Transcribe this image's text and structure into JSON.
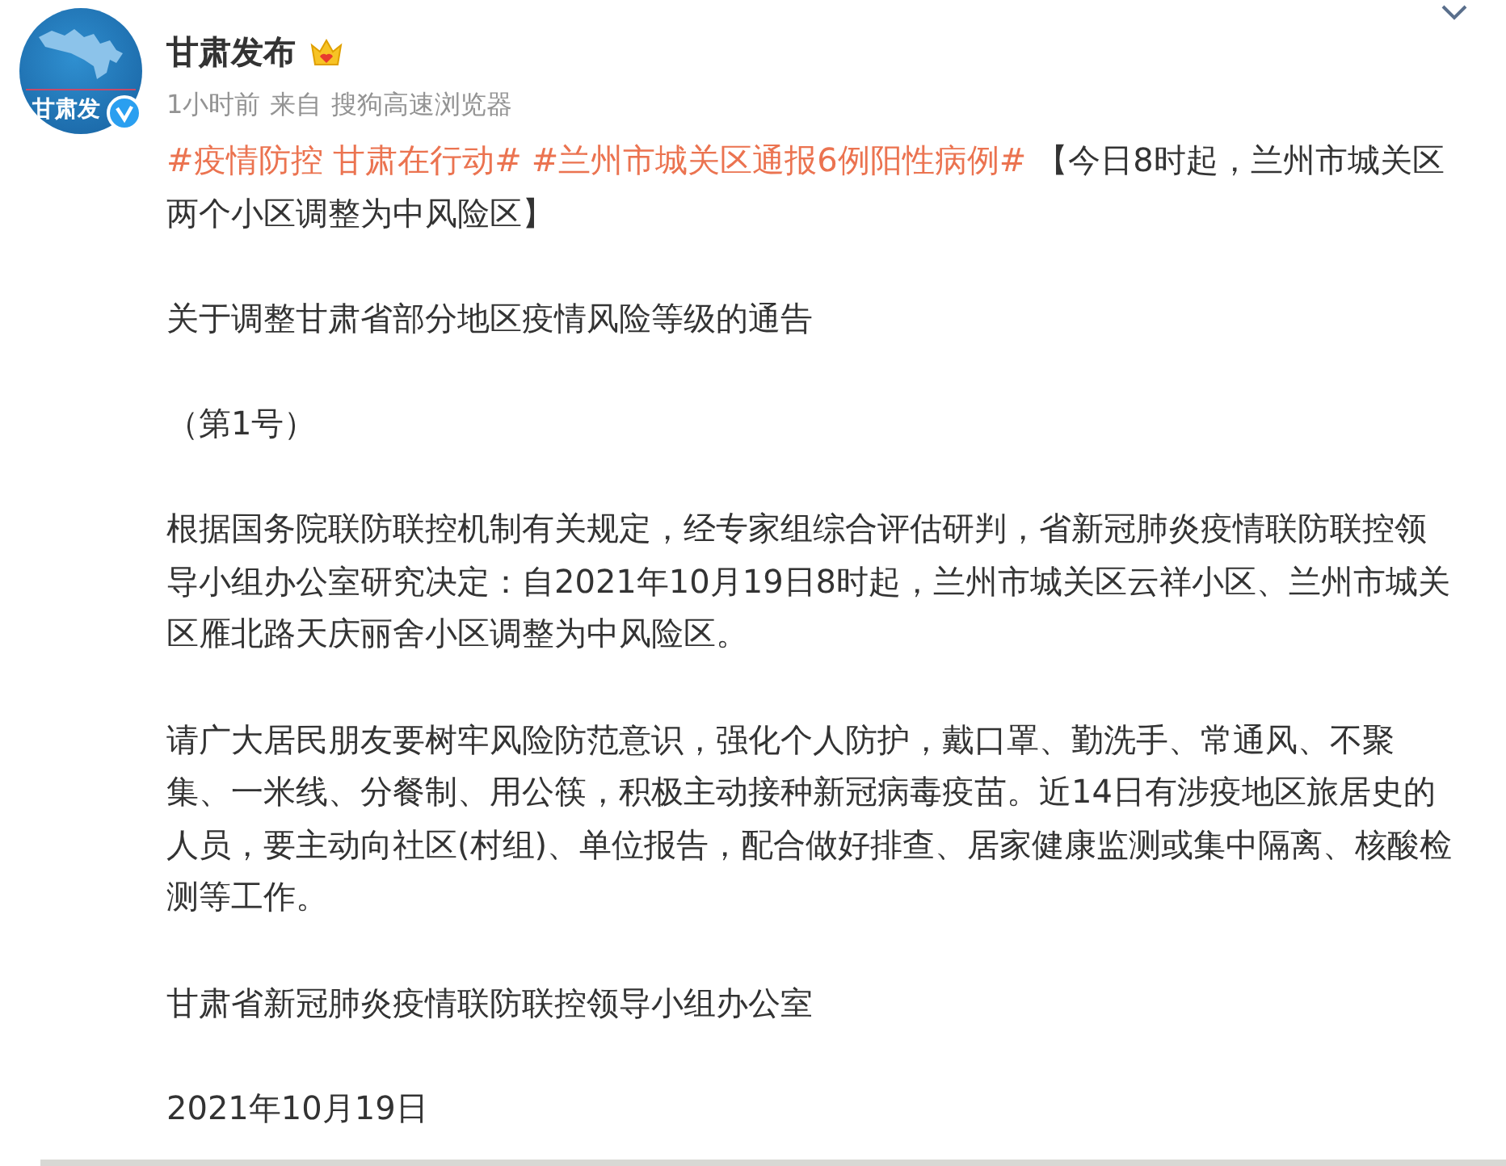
{
  "author": {
    "name": "甘肃发布",
    "avatar_text": "甘肃发"
  },
  "meta": {
    "time": "1小时前",
    "source_label": "来自",
    "source": "搜狗高速浏览器"
  },
  "post": [
    {
      "segments": [
        {
          "kind": "topic",
          "text": "#疫情防控 甘肃在行动#"
        },
        {
          "kind": "topic",
          "text": "#兰州市城关区通报6例阳性病例#"
        },
        {
          "kind": "text",
          "text": "【今日8时起，兰州市城关区两个小区调整为中风险区】"
        }
      ]
    },
    {
      "segments": [
        {
          "kind": "text",
          "text": "关于调整甘肃省部分地区疫情风险等级的通告"
        }
      ]
    },
    {
      "segments": [
        {
          "kind": "text",
          "text": "（第1号）"
        }
      ]
    },
    {
      "segments": [
        {
          "kind": "text",
          "text": "根据国务院联防联控机制有关规定，经专家组综合评估研判，省新冠肺炎疫情联防联控领导小组办公室研究决定：自2021年10月19日8时起，兰州市城关区云祥小区、兰州市城关区雁北路天庆丽舍小区调整为中风险区。"
        }
      ]
    },
    {
      "segments": [
        {
          "kind": "text",
          "text": "请广大居民朋友要树牢风险防范意识，强化个人防护，戴口罩、勤洗手、常通风、不聚集、一米线、分餐制、用公筷，积极主动接种新冠病毒疫苗。近14日有涉疫地区旅居史的人员，要主动向社区(村组)、单位报告，配合做好排查、居家健康监测或集中隔离、核酸检测等工作。"
        }
      ]
    },
    {
      "segments": [
        {
          "kind": "text",
          "text": "甘肃省新冠肺炎疫情联防联控领导小组办公室"
        }
      ]
    },
    {
      "segments": [
        {
          "kind": "text",
          "text": "2021年10月19日"
        }
      ]
    }
  ]
}
